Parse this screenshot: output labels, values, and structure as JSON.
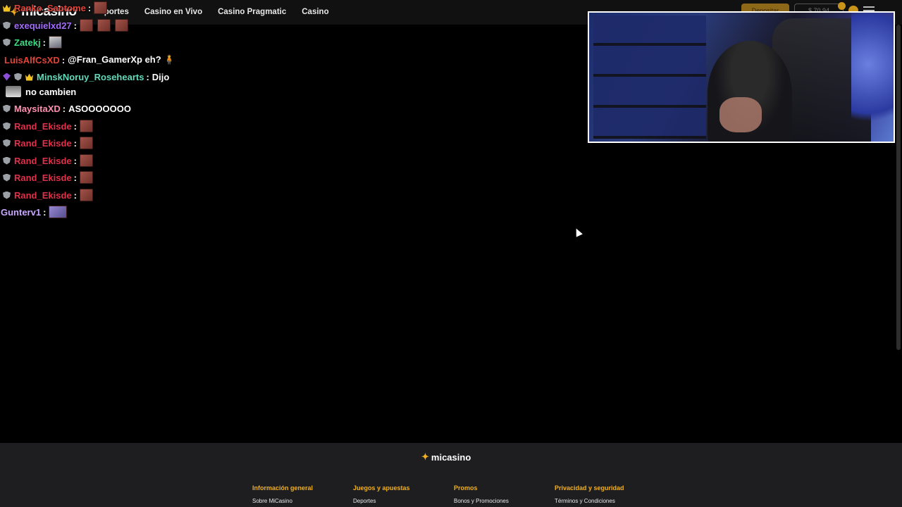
{
  "site": {
    "logo_text": "micasino",
    "nav": [
      "Deportes",
      "Casino en Vivo",
      "Casino Pragmatic",
      "Casino"
    ],
    "deposit_label": "Depositar",
    "balance_label": "$ 70,94"
  },
  "chat": [
    {
      "user": "Ranko_Saotome",
      "color": "#e0443a",
      "badges": [
        "crown"
      ],
      "text": "",
      "emotes": 1
    },
    {
      "user": "exequielxd27",
      "color": "#a46bff",
      "badges": [
        "shield"
      ],
      "text": "",
      "emotes": 3
    },
    {
      "user": "Zatekj",
      "color": "#3ddc84",
      "badges": [
        "shield"
      ],
      "text": "",
      "emotes": 1,
      "emote_style": "face"
    },
    {
      "user": "LuisAlfCsXD",
      "color": "#e0443a",
      "badges": [],
      "text": "@Fran_GamerXp eh? 🧍",
      "emotes": 0
    },
    {
      "user": "MinskNoruy_Rosehearts",
      "color": "#62d9b8",
      "badges": [
        "gem",
        "shield",
        "crown"
      ],
      "text": "Dijo",
      "emotes": 0
    },
    {
      "user": "",
      "color": "#ffffff",
      "badges": [],
      "text": "no cambien",
      "emotes": 0,
      "avatar": true
    },
    {
      "user": "MaysitaXD",
      "color": "#ff8fb1",
      "badges": [
        "shield"
      ],
      "text": "ASOOOOOOO",
      "emotes": 0
    },
    {
      "user": "Rand_Ekisde",
      "color": "#e0304a",
      "badges": [
        "shield"
      ],
      "text": "",
      "emotes": 1
    },
    {
      "user": "Rand_Ekisde",
      "color": "#e0304a",
      "badges": [
        "shield"
      ],
      "text": "",
      "emotes": 1
    },
    {
      "user": "Rand_Ekisde",
      "color": "#e0304a",
      "badges": [
        "shield"
      ],
      "text": "",
      "emotes": 1
    },
    {
      "user": "Rand_Ekisde",
      "color": "#e0304a",
      "badges": [
        "shield"
      ],
      "text": "",
      "emotes": 1
    },
    {
      "user": "Rand_Ekisde",
      "color": "#e0304a",
      "badges": [
        "shield"
      ],
      "text": "",
      "emotes": 1
    },
    {
      "user": "Gunterv1",
      "color": "#c9a8ff",
      "badges": [],
      "text": "",
      "emotes": 1,
      "emote_style": "blue"
    }
  ],
  "footer": {
    "logo_text": "micasino",
    "columns": [
      {
        "heading": "Información general",
        "link": "Sobre MiCasino"
      },
      {
        "heading": "Juegos y apuestas",
        "link": "Deportes"
      },
      {
        "heading": "Promos",
        "link": "Bonos y Promociones"
      },
      {
        "heading": "Privacidad y seguridad",
        "link": "Términos y Condiciones"
      }
    ]
  },
  "colors": {
    "accent": "#f2b01e",
    "background": "#000000",
    "footer_bg": "#1e1e20"
  }
}
